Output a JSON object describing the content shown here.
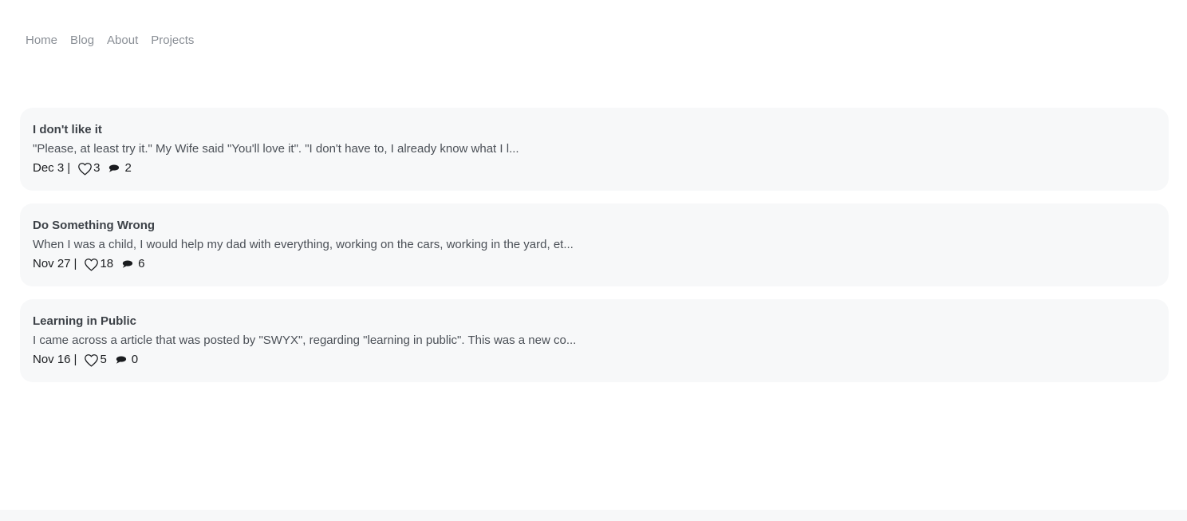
{
  "nav": {
    "items": [
      {
        "label": "Home"
      },
      {
        "label": "Blog"
      },
      {
        "label": "About"
      },
      {
        "label": "Projects"
      }
    ]
  },
  "posts": [
    {
      "title": "I don't like it",
      "excerpt": "\"Please, at least try it.\" My Wife said \"You'll love it\". \"I don't have to, I already know what I l...",
      "date": "Dec 3",
      "likes": "3",
      "comments": "2"
    },
    {
      "title": "Do Something Wrong",
      "excerpt": "When I was a child, I would help my dad with everything, working on the cars, working in the yard, et...",
      "date": "Nov 27",
      "likes": "18",
      "comments": "6"
    },
    {
      "title": "Learning in Public",
      "excerpt": "I came across a article that was posted by \"SWYX\", regarding \"learning in public\". This was a new co...",
      "date": "Nov 16",
      "likes": "5",
      "comments": "0"
    }
  ],
  "meta": {
    "separator": "|"
  },
  "icons": {
    "like": "heart-icon",
    "comment": "comment-icon"
  },
  "colors": {
    "nav_text": "#8a8f96",
    "card_bg": "#f7f8f9",
    "title_text": "#3d4248"
  }
}
